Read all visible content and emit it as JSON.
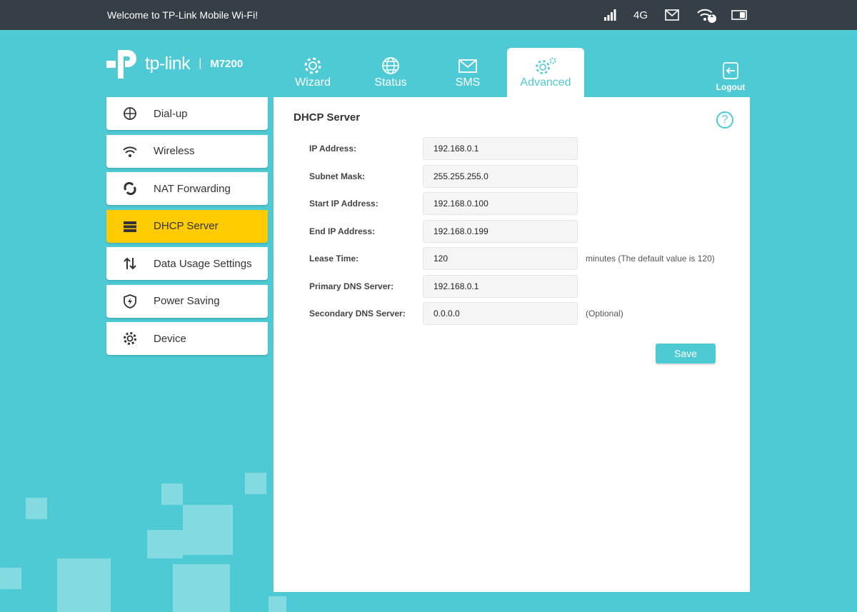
{
  "topbar": {
    "welcome": "Welcome to TP-Link Mobile Wi-Fi!",
    "network": "4G",
    "wifi_clients": "1"
  },
  "logo": {
    "brand": "tp-link",
    "separator": "|",
    "model": "M7200"
  },
  "tabs": [
    {
      "label": "Wizard"
    },
    {
      "label": "Status"
    },
    {
      "label": "SMS"
    },
    {
      "label": "Advanced",
      "active": true
    }
  ],
  "logout": "Logout",
  "sidebar": {
    "items": [
      {
        "label": "Dial-up"
      },
      {
        "label": "Wireless"
      },
      {
        "label": "NAT Forwarding"
      },
      {
        "label": "DHCP Server",
        "active": true
      },
      {
        "label": "Data Usage Settings"
      },
      {
        "label": "Power Saving"
      },
      {
        "label": "Device"
      }
    ]
  },
  "main": {
    "title": "DHCP Server",
    "help": "?",
    "fields": [
      {
        "label": "IP Address:",
        "value": "192.168.0.1"
      },
      {
        "label": "Subnet Mask:",
        "value": "255.255.255.0"
      },
      {
        "label": "Start IP Address:",
        "value": "192.168.0.100"
      },
      {
        "label": "End IP Address:",
        "value": "192.168.0.199"
      },
      {
        "label": "Lease Time:",
        "value": "120",
        "note": "minutes (The default value is 120)"
      },
      {
        "label": "Primary DNS Server:",
        "value": "192.168.0.1"
      },
      {
        "label": "Secondary DNS Server:",
        "value": "0.0.0.0",
        "note": "(Optional)"
      }
    ],
    "save_label": "Save"
  },
  "colors": {
    "accent": "#4ecad4",
    "topbar": "#363f46",
    "active_menu": "#fecb00"
  }
}
